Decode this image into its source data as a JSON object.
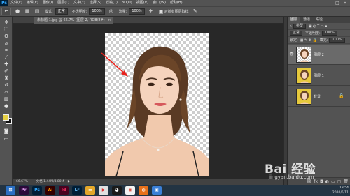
{
  "app": {
    "logo": "Ps",
    "menu": [
      "文件(F)",
      "编辑(E)",
      "图像(I)",
      "图层(L)",
      "文字(Y)",
      "选择(S)",
      "滤镜(T)",
      "3D(D)",
      "视图(V)",
      "窗口(W)",
      "帮助(H)"
    ]
  },
  "options_bar": {
    "mode_label": "模式:",
    "mode_value": "正常",
    "opacity_label": "不透明度:",
    "opacity_value": "100%",
    "flow_label": "流量:",
    "flow_value": "100%",
    "sample_all_layers": "对所有图层取样"
  },
  "document": {
    "tab_title": "未标题-1.jpg @ 66.7% (图层 2, RGB/8#)",
    "zoom": "66.67%",
    "doc_size": "文档:1.44M/4.80M"
  },
  "colors": {
    "foreground": "#e6d144",
    "background": "#111111",
    "arrow": "#e8221c"
  },
  "layers_panel": {
    "tabs": [
      "图层",
      "通道",
      "路径"
    ],
    "kind_label": "类型",
    "blend_mode": "正常",
    "opacity_label": "不透明度:",
    "opacity_value": "100%",
    "lock_label": "锁定:",
    "fill_label": "填充:",
    "fill_value": "100%",
    "layers": [
      {
        "name": "图层 2",
        "visible": true,
        "selected": true,
        "thumb_bg": "checker"
      },
      {
        "name": "图层 1",
        "visible": false,
        "selected": false,
        "thumb_bg": "#e6c93c"
      },
      {
        "name": "背景",
        "visible": false,
        "selected": false,
        "thumb_bg": "#e6c93c",
        "locked": true
      }
    ]
  },
  "taskbar": {
    "apps": [
      "windows-icon",
      "pr-icon",
      "ps-icon",
      "ai-icon",
      "id-icon",
      "lr-icon",
      "folder-icon",
      "media-icon",
      "qq-icon",
      "chrome-icon",
      "firefox-icon",
      "explorer-icon"
    ],
    "time": "13:54",
    "date": "2020/5/11"
  },
  "watermark": {
    "brand": "Bai 经验",
    "url": "jingyan.baidu.com"
  }
}
